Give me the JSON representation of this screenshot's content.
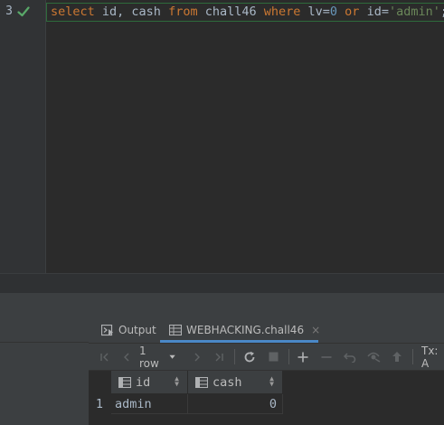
{
  "editor": {
    "line_number": "3",
    "status_icon": "check-icon",
    "sql": {
      "kw_select": "select",
      "cols": " id, cash ",
      "kw_from": "from",
      "table": " chall46 ",
      "kw_where": "where",
      "cond1_field": " lv=",
      "cond1_value": "0",
      "space1": " ",
      "kw_or": "or",
      "cond2_field": " id=",
      "cond2_value": "'admin'",
      "terminator": ";"
    }
  },
  "results_panel": {
    "tabs": [
      {
        "label": "Output",
        "icon": "output-icon"
      },
      {
        "label": "WEBHACKING.chall46",
        "icon": "table-icon",
        "close": "×"
      }
    ],
    "toolbar": {
      "rows_label": "1 row",
      "tx_label": "Tx: A"
    },
    "columns": [
      {
        "name": "id",
        "icon": "column-icon"
      },
      {
        "name": "cash",
        "icon": "column-icon"
      }
    ],
    "rows": [
      {
        "num": "1",
        "id": "admin",
        "cash": "0"
      }
    ]
  },
  "colors": {
    "keyword": "#cc7832",
    "string": "#6a8759",
    "number": "#6897bb",
    "check": "#59a869",
    "active_tab": "#4a88c7"
  }
}
